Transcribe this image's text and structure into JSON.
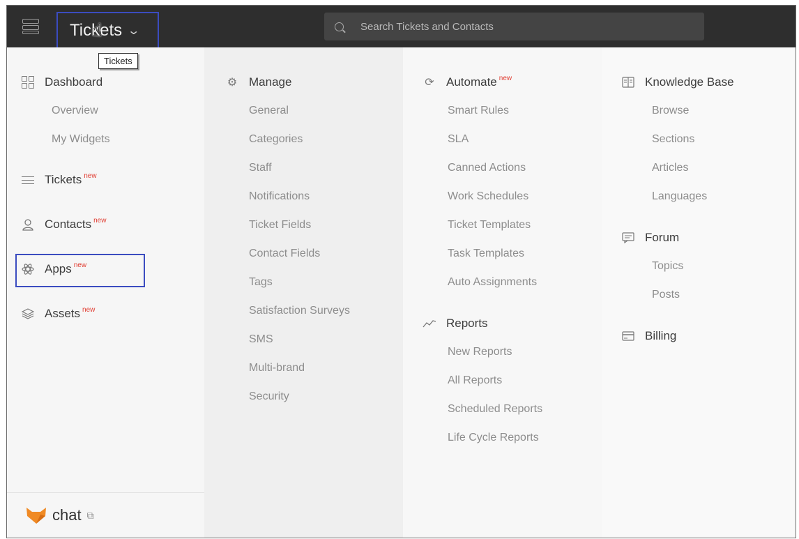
{
  "topbar": {
    "module_label": "Tickets",
    "tooltip": "Tickets",
    "search_placeholder": "Search Tickets and Contacts"
  },
  "sidebar": {
    "dashboard": {
      "label": "Dashboard",
      "items": [
        "Overview",
        "My Widgets"
      ]
    },
    "tickets": {
      "label": "Tickets",
      "badge": "new"
    },
    "contacts": {
      "label": "Contacts",
      "badge": "new"
    },
    "apps": {
      "label": "Apps",
      "badge": "new"
    },
    "assets": {
      "label": "Assets",
      "badge": "new"
    },
    "chat": {
      "label": "chat"
    }
  },
  "manage": {
    "label": "Manage",
    "items": [
      "General",
      "Categories",
      "Staff",
      "Notifications",
      "Ticket Fields",
      "Contact Fields",
      "Tags",
      "Satisfaction Surveys",
      "SMS",
      "Multi-brand",
      "Security"
    ]
  },
  "automate": {
    "label": "Automate",
    "badge": "new",
    "items": [
      "Smart Rules",
      "SLA",
      "Canned Actions",
      "Work Schedules",
      "Ticket Templates",
      "Task Templates",
      "Auto Assignments"
    ]
  },
  "reports": {
    "label": "Reports",
    "items": [
      "New Reports",
      "All Reports",
      "Scheduled Reports",
      "Life Cycle Reports"
    ]
  },
  "knowledge_base": {
    "label": "Knowledge Base",
    "items": [
      "Browse",
      "Sections",
      "Articles",
      "Languages"
    ]
  },
  "forum": {
    "label": "Forum",
    "items": [
      "Topics",
      "Posts"
    ]
  },
  "billing": {
    "label": "Billing"
  },
  "colors": {
    "topbar": "#2e2e2e",
    "highlight": "#3b4cc0",
    "badge": "#e03c31",
    "chat_brand": "#f08a24"
  }
}
